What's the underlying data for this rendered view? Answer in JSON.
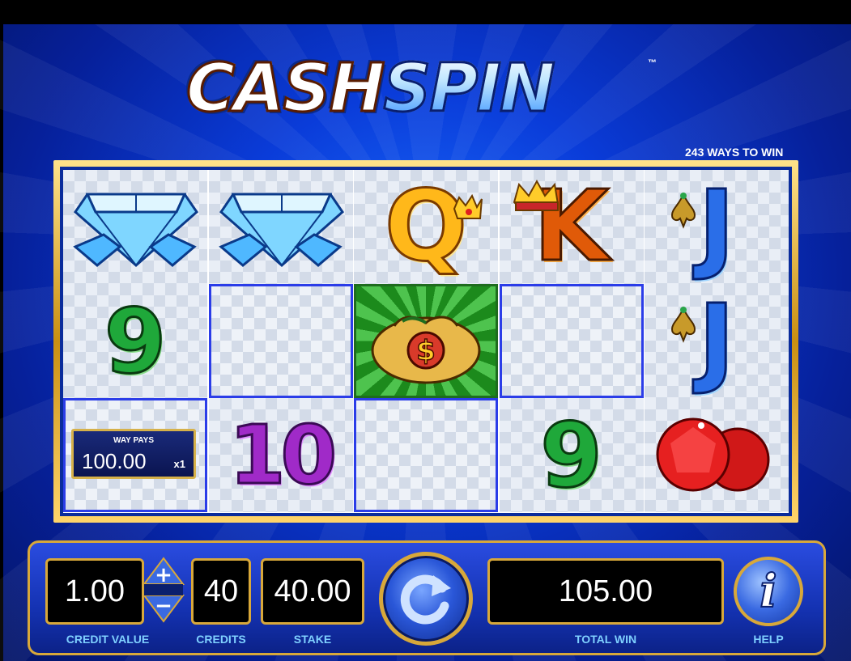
{
  "game": {
    "title_part1": "CASH",
    "title_part2": "SPIN",
    "trademark": "™",
    "ways_to_win": "243 WAYS TO WIN"
  },
  "reels": [
    [
      {
        "symbol": "diamonds",
        "text": ""
      },
      {
        "symbol": "nine",
        "text": "9"
      },
      {
        "symbol": "blank-highlight",
        "text": ""
      }
    ],
    [
      {
        "symbol": "diamonds",
        "text": ""
      },
      {
        "symbol": "blank-highlight",
        "text": ""
      },
      {
        "symbol": "ten",
        "text": "10"
      }
    ],
    [
      {
        "symbol": "queen",
        "text": "Q"
      },
      {
        "symbol": "money-bag",
        "text": ""
      },
      {
        "symbol": "blank-highlight",
        "text": ""
      }
    ],
    [
      {
        "symbol": "king",
        "text": "K"
      },
      {
        "symbol": "blank-highlight",
        "text": ""
      },
      {
        "symbol": "nine",
        "text": "9"
      }
    ],
    [
      {
        "symbol": "jack",
        "text": "J"
      },
      {
        "symbol": "jack",
        "text": "J"
      },
      {
        "symbol": "rubies",
        "text": ""
      }
    ]
  ],
  "win_badge": {
    "label": "WAY PAYS",
    "amount": "100.00",
    "multiplier": "x1"
  },
  "controls": {
    "credit_value": "1.00",
    "credit_value_label": "CREDIT VALUE",
    "credits": "40",
    "credits_label": "CREDITS",
    "stake": "40.00",
    "stake_label": "STAKE",
    "total_win": "105.00",
    "total_win_label": "TOTAL WIN",
    "help_label": "HELP",
    "help_glyph": "i",
    "plus": "+",
    "minus": "−",
    "spin_icon": "refresh-arrow-icon"
  },
  "colors": {
    "gold": "#d8a83a",
    "label_blue": "#7fd0ff",
    "background_blue": "#0a3cd9"
  }
}
